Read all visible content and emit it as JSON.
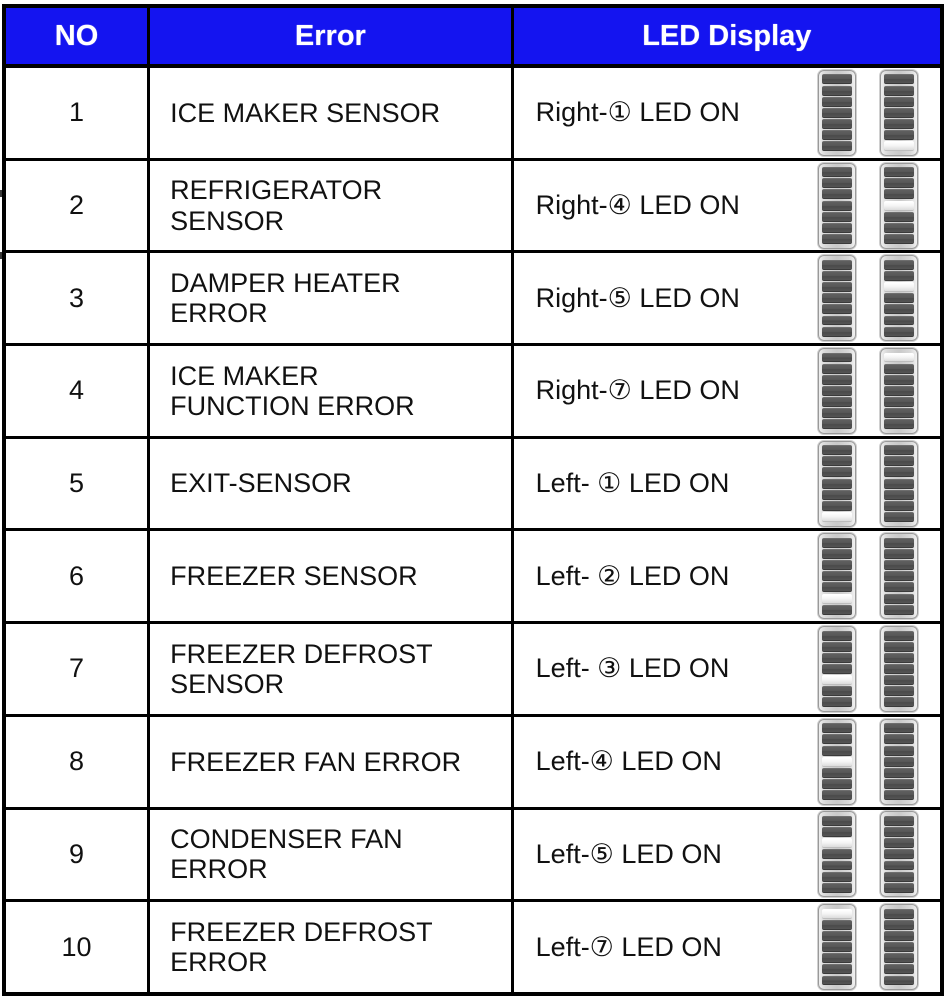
{
  "table": {
    "headers": {
      "no": "NO",
      "error": "Error",
      "led_display": "LED Display"
    },
    "header_bg": "#1414f0",
    "header_fg": "#ffffff",
    "border_color": "#000000",
    "body_bg": "#ffffff",
    "led_segment_count": 7,
    "led_panel_count": 2,
    "rows": [
      {
        "no": "1",
        "error_line1": "ICE MAKER SENSOR",
        "error_line2": "",
        "led_text": "Right-① LED ON",
        "side": "Right",
        "led_number": 1,
        "panels": [
          {
            "name": "left-panel",
            "lit_segment": 0
          },
          {
            "name": "right-panel",
            "lit_segment": 7
          }
        ]
      },
      {
        "no": "2",
        "error_line1": "REFRIGERATOR",
        "error_line2": "SENSOR",
        "led_text": "Right-④ LED ON",
        "side": "Right",
        "led_number": 4,
        "panels": [
          {
            "name": "left-panel",
            "lit_segment": 0
          },
          {
            "name": "right-panel",
            "lit_segment": 4
          }
        ]
      },
      {
        "no": "3",
        "error_line1": "DAMPER HEATER",
        "error_line2": "ERROR",
        "led_text": "Right-⑤ LED ON",
        "side": "Right",
        "led_number": 5,
        "panels": [
          {
            "name": "left-panel",
            "lit_segment": 0
          },
          {
            "name": "right-panel",
            "lit_segment": 3
          }
        ]
      },
      {
        "no": "4",
        "error_line1": "ICE MAKER",
        "error_line2": "FUNCTION ERROR",
        "led_text": "Right-⑦ LED ON",
        "side": "Right",
        "led_number": 7,
        "panels": [
          {
            "name": "left-panel",
            "lit_segment": 0
          },
          {
            "name": "right-panel",
            "lit_segment": 1
          }
        ]
      },
      {
        "no": "5",
        "error_line1": "EXIT-SENSOR",
        "error_line2": "",
        "led_text": "Left- ① LED ON",
        "side": "Left",
        "led_number": 1,
        "panels": [
          {
            "name": "left-panel",
            "lit_segment": 7
          },
          {
            "name": "right-panel",
            "lit_segment": 0
          }
        ]
      },
      {
        "no": "6",
        "error_line1": "FREEZER SENSOR",
        "error_line2": "",
        "led_text": "Left- ② LED ON",
        "side": "Left",
        "led_number": 2,
        "panels": [
          {
            "name": "left-panel",
            "lit_segment": 6
          },
          {
            "name": "right-panel",
            "lit_segment": 0
          }
        ]
      },
      {
        "no": "7",
        "error_line1": "FREEZER DEFROST",
        "error_line2": "SENSOR",
        "led_text": "Left- ③ LED ON",
        "side": "Left",
        "led_number": 3,
        "panels": [
          {
            "name": "left-panel",
            "lit_segment": 5
          },
          {
            "name": "right-panel",
            "lit_segment": 0
          }
        ]
      },
      {
        "no": "8",
        "error_line1": "FREEZER FAN ERROR",
        "error_line2": "",
        "led_text": "Left-④ LED ON",
        "side": "Left",
        "led_number": 4,
        "panels": [
          {
            "name": "left-panel",
            "lit_segment": 4
          },
          {
            "name": "right-panel",
            "lit_segment": 0
          }
        ]
      },
      {
        "no": "9",
        "error_line1": "CONDENSER FAN",
        "error_line2": "ERROR",
        "led_text": "Left-⑤ LED ON",
        "side": "Left",
        "led_number": 5,
        "panels": [
          {
            "name": "left-panel",
            "lit_segment": 3
          },
          {
            "name": "right-panel",
            "lit_segment": 0
          }
        ]
      },
      {
        "no": "10",
        "error_line1": "FREEZER DEFROST",
        "error_line2": "ERROR",
        "led_text": "Left-⑦ LED ON",
        "side": "Left",
        "led_number": 7,
        "panels": [
          {
            "name": "left-panel",
            "lit_segment": 1
          },
          {
            "name": "right-panel",
            "lit_segment": 0
          }
        ]
      }
    ]
  }
}
